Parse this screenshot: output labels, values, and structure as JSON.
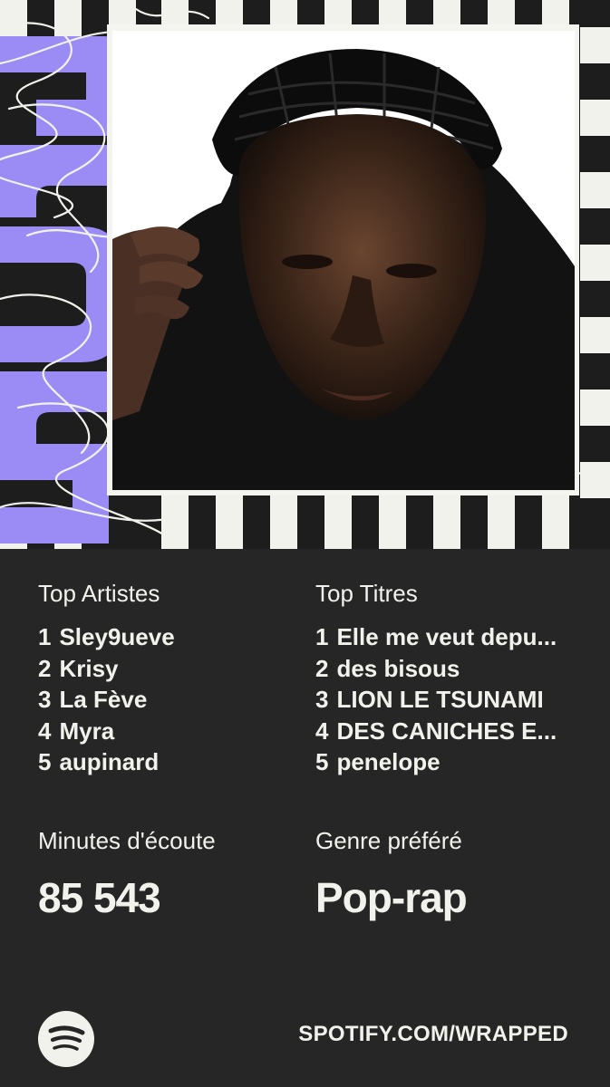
{
  "year_art_label": "2025",
  "top_artists": {
    "label": "Top Artistes",
    "items": [
      {
        "rank": "1",
        "name": "Sley9ueve"
      },
      {
        "rank": "2",
        "name": "Krisy"
      },
      {
        "rank": "3",
        "name": "La Fève"
      },
      {
        "rank": "4",
        "name": "Myra"
      },
      {
        "rank": "5",
        "name": "aupinard"
      }
    ]
  },
  "top_tracks": {
    "label": "Top Titres",
    "items": [
      {
        "rank": "1",
        "name": "Elle me veut depu..."
      },
      {
        "rank": "2",
        "name": "des bisous"
      },
      {
        "rank": "3",
        "name": "LION LE TSUNAMI"
      },
      {
        "rank": "4",
        "name": "DES CANICHES E..."
      },
      {
        "rank": "5",
        "name": "penelope"
      }
    ]
  },
  "minutes": {
    "label": "Minutes d'écoute",
    "value": "85 543"
  },
  "genre": {
    "label": "Genre préféré",
    "value": "Pop-rap"
  },
  "footer": {
    "url": "SPOTIFY.COM/WRAPPED",
    "logo_icon": "spotify-logo-icon"
  },
  "colors": {
    "background": "#262626",
    "accent_purple": "#9b8cf5",
    "checker_light": "#f2f2ed",
    "text": "#f2f2ed"
  }
}
